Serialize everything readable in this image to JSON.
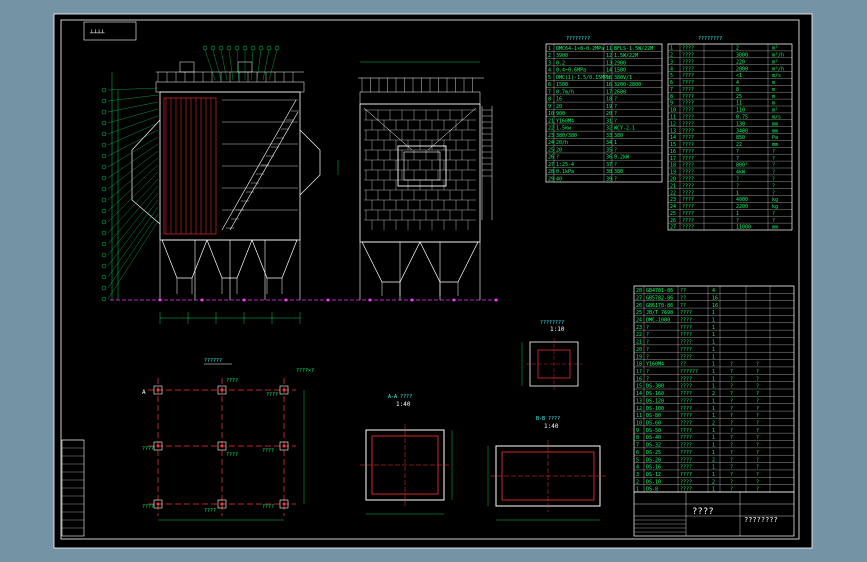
{
  "drawing": {
    "view_tabs": "┴┴┴┴",
    "params_title_left": "????????",
    "params_title_right": "????????",
    "plan_title": "??????",
    "section_a_title": "A-A ????",
    "section_a_scale": "1:40",
    "section_b_title": "B-B ????",
    "section_b_scale": "1:40",
    "detail_title": "????????",
    "detail_scale": "1:10",
    "title_block_name": "????",
    "title_block_code": "????????"
  },
  "param_table_left": [
    [
      "1",
      "DMC64-1×8-0.2MPa",
      "11",
      "BFLS-1.5W/22M"
    ],
    [
      "2",
      "3900",
      "12",
      "1.5W/22M"
    ],
    [
      "3",
      "0.2",
      "13",
      "2900"
    ],
    [
      "4",
      "0.4~0.6MPa",
      "14",
      "1500"
    ],
    [
      "5",
      "DMC(1)-1.5/0.15MPa",
      "15",
      "380V/1"
    ],
    [
      "6",
      "1500",
      "16",
      "3200-2800"
    ],
    [
      "7",
      "0.7m/h",
      "17",
      "2600"
    ],
    [
      "8",
      "16",
      "18",
      "?"
    ],
    [
      "9",
      "20",
      "19",
      "?"
    ],
    [
      "10",
      "900",
      "20",
      "?"
    ],
    [
      "21",
      "Y160M4",
      "31",
      "?"
    ],
    [
      "22",
      "1.5kw",
      "32",
      "WCY-2.1"
    ],
    [
      "23",
      "380/380",
      "33",
      "380"
    ],
    [
      "24",
      "20/h",
      "34",
      "1"
    ],
    [
      "25",
      "20",
      "35",
      "?"
    ],
    [
      "26",
      "?",
      "36",
      "0.2kW"
    ],
    [
      "27",
      "1:25-4",
      "37",
      "?"
    ],
    [
      "28",
      "0.1kPa",
      "38",
      "380"
    ],
    [
      "29",
      "40",
      "39",
      "?"
    ]
  ],
  "param_table_right": [
    [
      "1",
      "????",
      "2",
      "2",
      "m²"
    ],
    [
      "2",
      "????",
      "3000",
      "3000",
      "m³/h"
    ],
    [
      "3",
      "????",
      "220",
      "220",
      "m²"
    ],
    [
      "4",
      "????",
      "2000",
      "2000",
      "m³/h"
    ],
    [
      "5",
      "????",
      "<1",
      "<1",
      "m/s"
    ],
    [
      "6",
      "????",
      "4",
      "4",
      "m"
    ],
    [
      "7",
      "????",
      "8",
      "8",
      "m"
    ],
    [
      "8",
      "????",
      "25",
      "25",
      "m"
    ],
    [
      "9",
      "????",
      "11",
      "11",
      "m"
    ],
    [
      "10",
      "????",
      "110",
      "110",
      "m²"
    ],
    [
      "11",
      "????",
      "0.75",
      "0.75",
      "m/s"
    ],
    [
      "12",
      "????",
      "130",
      "130",
      "mm"
    ],
    [
      "13",
      "????",
      "3400",
      "3400",
      "mm"
    ],
    [
      "14",
      "????",
      "850",
      "850",
      "Pa"
    ],
    [
      "15",
      "????",
      "22",
      "22",
      "mm"
    ],
    [
      "16",
      "????",
      "?",
      "?",
      "?"
    ],
    [
      "17",
      "????",
      "?",
      "?",
      "?"
    ],
    [
      "18",
      "????",
      "800°",
      "800°",
      "?"
    ],
    [
      "19",
      "????",
      "BCP 4kW",
      "4kW",
      "?"
    ],
    [
      "20",
      "????",
      "?",
      "?",
      "?"
    ],
    [
      "21",
      "????",
      "?",
      "?",
      "?"
    ],
    [
      "22",
      "????",
      "1",
      "1",
      "?"
    ],
    [
      "23",
      "????",
      "4000",
      "4000",
      "kg"
    ],
    [
      "24",
      "????",
      "2200",
      "2200",
      "kg"
    ],
    [
      "25",
      "????",
      "1",
      "1",
      "?"
    ],
    [
      "26",
      "????",
      "?",
      "?",
      "?"
    ],
    [
      "27",
      "????",
      "11000",
      "11000",
      "mm"
    ]
  ],
  "parts_list": [
    [
      "28",
      "GB4701-86",
      "??",
      "4",
      "",
      ""
    ],
    [
      "27",
      "GB5782-86",
      "??",
      "16",
      "",
      ""
    ],
    [
      "26",
      "GB6170-86",
      "??",
      "16",
      "",
      ""
    ],
    [
      "25",
      "JB/T 7698",
      "????",
      "1",
      "",
      ""
    ],
    [
      "24",
      "DMC-1000",
      "????",
      "1",
      "",
      ""
    ],
    [
      "23",
      "?",
      "????",
      "1",
      "",
      ""
    ],
    [
      "22",
      "?",
      "????",
      "1",
      "",
      ""
    ],
    [
      "21",
      "?",
      "????",
      "1",
      "",
      ""
    ],
    [
      "20",
      "?",
      "????",
      "1",
      "",
      ""
    ],
    [
      "19",
      "?",
      "????",
      "1",
      "",
      ""
    ],
    [
      "18",
      "Y160M4",
      "??",
      "1",
      "?",
      "?"
    ],
    [
      "17",
      "?",
      "??????",
      "1",
      "?",
      "?"
    ],
    [
      "16",
      "?",
      "????",
      "1",
      "?",
      "?"
    ],
    [
      "15",
      "DS-300",
      "????",
      "1",
      "?",
      "?"
    ],
    [
      "14",
      "DS-160",
      "????",
      "2",
      "?",
      "?"
    ],
    [
      "13",
      "DS-120",
      "????",
      "1",
      "?",
      "?"
    ],
    [
      "12",
      "DS-100",
      "????",
      "1",
      "?",
      "?"
    ],
    [
      "11",
      "DS-80",
      "????",
      "1",
      "?",
      "?"
    ],
    [
      "10",
      "DS-60",
      "????",
      "2",
      "?",
      "?"
    ],
    [
      "9",
      "DS-50",
      "????",
      "1",
      "?",
      "?"
    ],
    [
      "8",
      "DS-40",
      "????",
      "1",
      "?",
      "?"
    ],
    [
      "7",
      "DS-32",
      "????",
      "1",
      "?",
      "?"
    ],
    [
      "6",
      "DS-25",
      "????",
      "1",
      "?",
      "?"
    ],
    [
      "5",
      "DS-20",
      "????",
      "2",
      "?",
      "?"
    ],
    [
      "4",
      "DS-16",
      "????",
      "1",
      "?",
      "?"
    ],
    [
      "3",
      "DS-12",
      "????",
      "1",
      "?",
      "?"
    ],
    [
      "2",
      "DS-10",
      "????",
      "2",
      "?",
      "?"
    ],
    [
      "1",
      "DS-8",
      "????",
      "1",
      "?",
      "?"
    ]
  ],
  "plan_labels": {
    "top_left": "A",
    "top_mid": "????",
    "top_right": "????",
    "mid_left": "????",
    "mid_mid": "????",
    "mid_right": "????",
    "bot_left": "????",
    "bot_mid": "????",
    "bot_right": "????",
    "note": "????×?"
  },
  "colors": {
    "background": "#7493a5",
    "sheet": "#000000",
    "frame": "#ffffff",
    "steel": "#ffffff",
    "hopper": "#ff3333",
    "dim": "#00ff66",
    "axis": "#ff33ff",
    "text": "#33ffff"
  }
}
